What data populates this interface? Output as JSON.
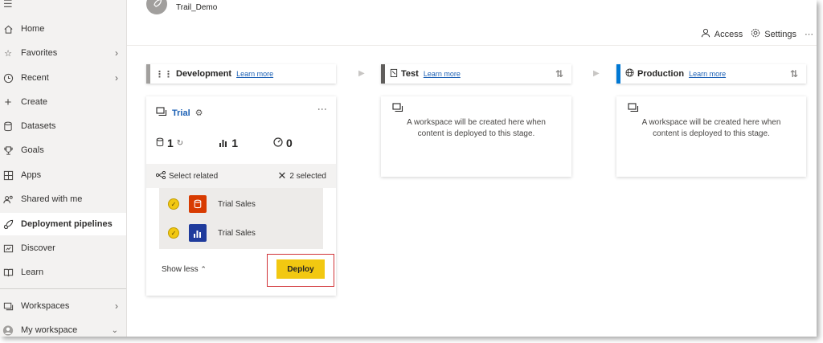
{
  "sidebar": {
    "items": [
      {
        "label": "Home",
        "icon": "home-icon"
      },
      {
        "label": "Favorites",
        "icon": "star-icon"
      },
      {
        "label": "Recent",
        "icon": "clock-icon"
      },
      {
        "label": "Create",
        "icon": "plus-icon"
      },
      {
        "label": "Datasets",
        "icon": "cylinder-icon"
      },
      {
        "label": "Goals",
        "icon": "trophy-icon"
      },
      {
        "label": "Apps",
        "icon": "apps-icon"
      },
      {
        "label": "Shared with me",
        "icon": "people-icon"
      },
      {
        "label": "Deployment pipelines",
        "icon": "rocket-icon"
      },
      {
        "label": "Discover",
        "icon": "discover-icon"
      },
      {
        "label": "Learn",
        "icon": "book-icon"
      },
      {
        "label": "Workspaces",
        "icon": "workspaces-icon"
      },
      {
        "label": "My workspace",
        "icon": "user-icon"
      }
    ],
    "active": "Deployment pipelines"
  },
  "header": {
    "workspace_name": "Trail_Demo",
    "access_label": "Access",
    "settings_label": "Settings"
  },
  "stages": [
    {
      "name": "Development",
      "learn": "Learn more",
      "bar_color": "#a19f9d"
    },
    {
      "name": "Test",
      "learn": "Learn more",
      "bar_color": "#605e5c"
    },
    {
      "name": "Production",
      "learn": "Learn more",
      "bar_color": "#0078d4"
    }
  ],
  "dev_card": {
    "workspace_title": "Trial",
    "datasets_count": "1",
    "reports_count": "1",
    "dashboards_count": "0",
    "select_related": "Select related",
    "selected_count": "2 selected",
    "items": [
      {
        "name": "Trial Sales",
        "type": "dataset",
        "color": "#d83b01"
      },
      {
        "name": "Trial Sales",
        "type": "report",
        "color": "#1f3b9c"
      }
    ],
    "show_less": "Show less",
    "deploy_label": "Deploy"
  },
  "empty_stage_text": "A workspace will be created here when content is deployed to this stage.",
  "colors": {
    "accent_yellow": "#f2c811",
    "highlight_red": "#d13438",
    "link_blue": "#1a5fb4"
  }
}
